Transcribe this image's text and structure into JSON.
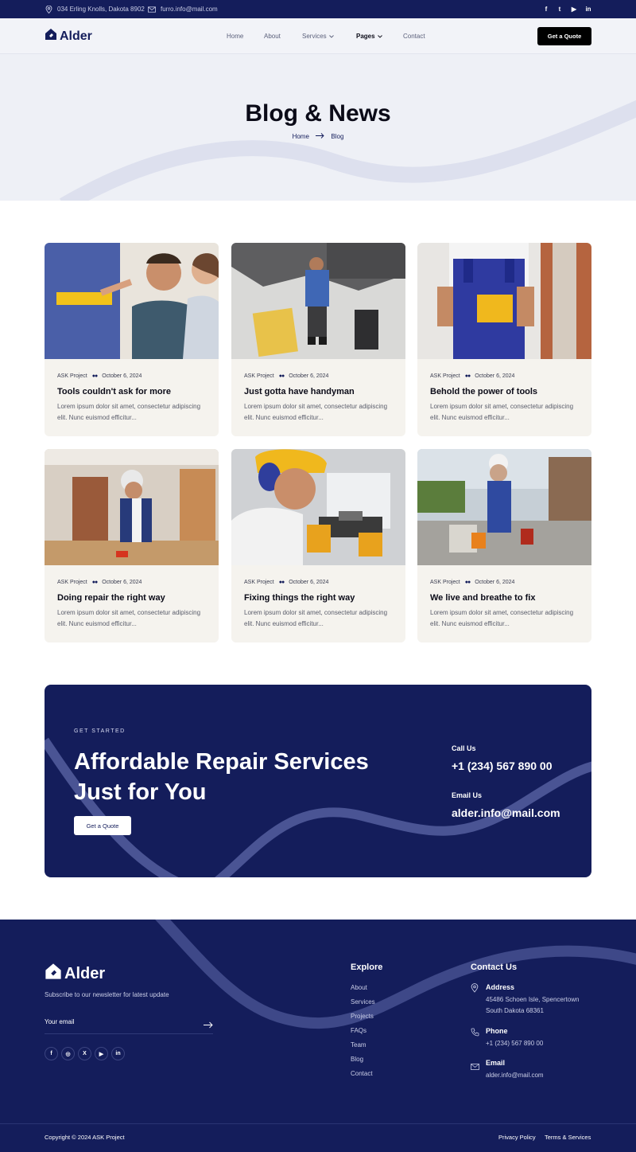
{
  "topbar": {
    "address": "034 Erling Knolls, Dakota 8902",
    "email": "furro.info@mail.com",
    "social": [
      "f",
      "t",
      "▶",
      "in"
    ]
  },
  "nav": {
    "brand": "Alder",
    "menu": {
      "home": "Home",
      "about": "About",
      "services": "Services",
      "pages": "Pages",
      "contact": "Contact"
    },
    "cta": "Get a Quote"
  },
  "hero": {
    "title": "Blog & News",
    "crumb_home": "Home",
    "crumb_current": "Blog"
  },
  "posts": [
    {
      "category": "ASK Project",
      "date": "October 6, 2024",
      "title": "Tools couldn't ask for more",
      "excerpt": "Lorem ipsum dolor sit amet, consectetur adipiscing elit. Nunc euismod efficitur..."
    },
    {
      "category": "ASK Project",
      "date": "October 6, 2024",
      "title": "Just gotta have handyman",
      "excerpt": "Lorem ipsum dolor sit amet, consectetur adipiscing elit. Nunc euismod efficitur..."
    },
    {
      "category": "ASK Project",
      "date": "October 6, 2024",
      "title": "Behold the power of tools",
      "excerpt": "Lorem ipsum dolor sit amet, consectetur adipiscing elit. Nunc euismod efficitur..."
    },
    {
      "category": "ASK Project",
      "date": "October 6, 2024",
      "title": "Doing repair the right way",
      "excerpt": "Lorem ipsum dolor sit amet, consectetur adipiscing elit. Nunc euismod efficitur..."
    },
    {
      "category": "ASK Project",
      "date": "October 6, 2024",
      "title": "Fixing things the right way",
      "excerpt": "Lorem ipsum dolor sit amet, consectetur adipiscing elit. Nunc euismod efficitur..."
    },
    {
      "category": "ASK Project",
      "date": "October 6, 2024",
      "title": "We live and breathe to fix",
      "excerpt": "Lorem ipsum dolor sit amet, consectetur adipiscing elit. Nunc euismod efficitur..."
    }
  ],
  "cta": {
    "eyebrow": "GET STARTED",
    "headline_line1": "Affordable Repair Services",
    "headline_line2": "Just for You",
    "button": "Get a Quote",
    "call_label": "Call Us",
    "call_value": "+1 (234) 567 890 00",
    "email_label": "Email Us",
    "email_value": "alder.info@mail.com"
  },
  "footer": {
    "brand": "Alder",
    "tagline": "Subscribe to our newsletter for latest update",
    "email_placeholder": "Your email",
    "social": [
      "f",
      "◎",
      "X",
      "▶",
      "in"
    ],
    "explore_title": "Explore",
    "explore_links": [
      "About",
      "Services",
      "Projects",
      "FAQs",
      "Team",
      "Blog",
      "Contact"
    ],
    "contact_title": "Contact Us",
    "address_label": "Address",
    "address_line1": "45486 Schoen Isle, Spencertown",
    "address_line2": "South Dakota 68361",
    "phone_label": "Phone",
    "phone_value": "+1 (234) 567 890 00",
    "email_label": "Email",
    "email_value": "alder.info@mail.com",
    "copyright": "Copyright © 2024 ASK Project",
    "privacy": "Privacy Policy",
    "terms": "Terms & Services"
  },
  "colors": {
    "navy": "#141d5b",
    "card_bg": "#f5f3ee",
    "hero_bg": "#eef0f6"
  }
}
